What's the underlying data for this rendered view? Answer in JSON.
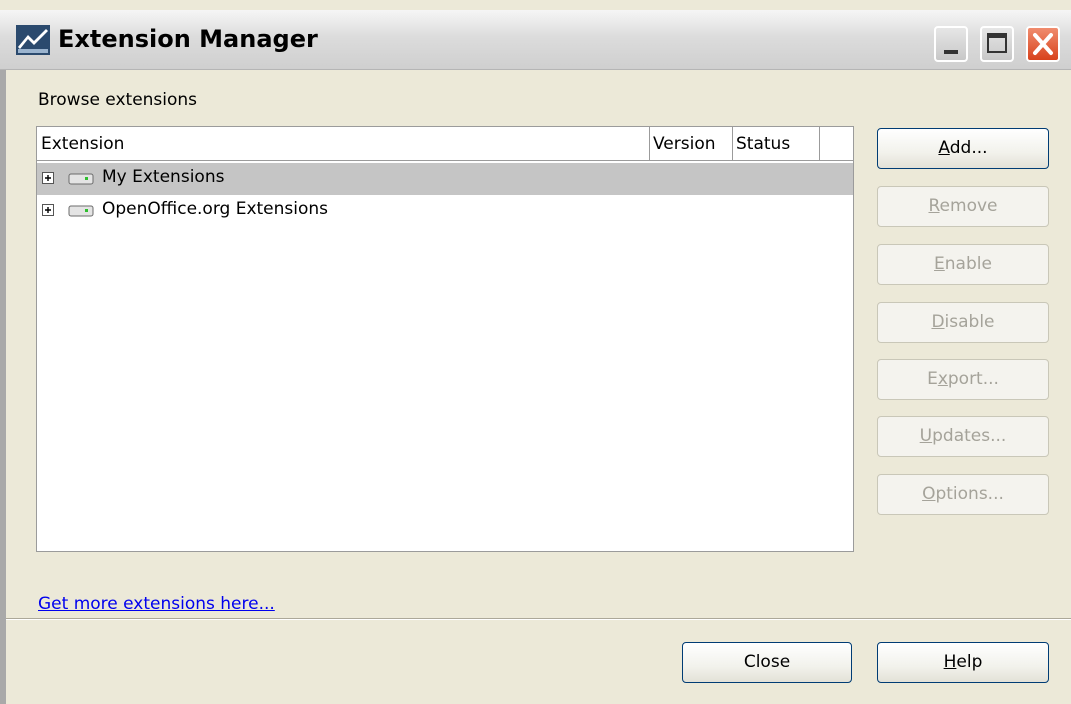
{
  "window": {
    "title": "Extension Manager",
    "controls": [
      "minimize-icon",
      "maximize-icon",
      "close-icon"
    ],
    "close_color": "#d8421c"
  },
  "main": {
    "browse_label": "Browse extensions",
    "columns": [
      "Extension",
      "Version",
      "Status"
    ],
    "rows": [
      {
        "label": "My Extensions",
        "selected": true,
        "icon": "drive-icon"
      },
      {
        "label": "OpenOffice.org Extensions",
        "selected": false,
        "icon": "drive-icon"
      }
    ],
    "link_text": "Get more extensions here..."
  },
  "side_buttons": [
    {
      "label": "Add...",
      "mnemonic": "A",
      "rest": "dd...",
      "enabled": true
    },
    {
      "label": "Remove",
      "mnemonic": "R",
      "rest": "emove",
      "enabled": false
    },
    {
      "label": "Enable",
      "mnemonic": "E",
      "rest": "nable",
      "enabled": false
    },
    {
      "label": "Disable",
      "mnemonic": "D",
      "rest": "isable",
      "enabled": false
    },
    {
      "label": "Export...",
      "mnemonic": "x",
      "prefix": "E",
      "rest": "port...",
      "enabled": false
    },
    {
      "label": "Updates...",
      "mnemonic": "U",
      "rest": "pdates...",
      "enabled": false
    },
    {
      "label": "Options...",
      "mnemonic": "O",
      "rest": "ptions...",
      "enabled": false
    }
  ],
  "footer": {
    "close_label": "Close",
    "help_mnemonic": "H",
    "help_rest": "elp",
    "help_label": "Help"
  }
}
